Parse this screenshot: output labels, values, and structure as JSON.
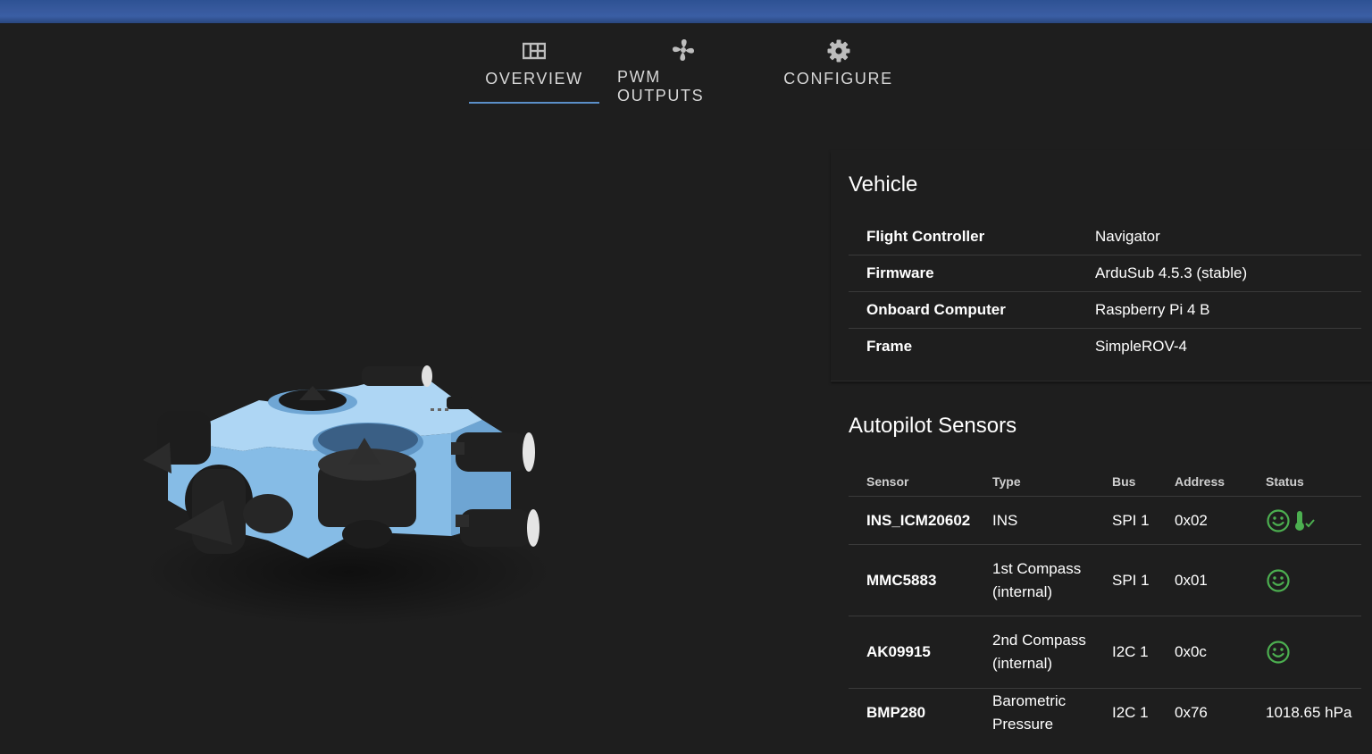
{
  "tabs": [
    {
      "label": "OVERVIEW",
      "icon": "grid-icon",
      "active": true
    },
    {
      "label": "PWM OUTPUTS",
      "icon": "fan-icon",
      "active": false
    },
    {
      "label": "CONFIGURE",
      "icon": "gear-icon",
      "active": false
    }
  ],
  "vehicle": {
    "title": "Vehicle",
    "rows": [
      {
        "key": "Flight Controller",
        "value": "Navigator"
      },
      {
        "key": "Firmware",
        "value": "ArduSub 4.5.3 (stable)"
      },
      {
        "key": "Onboard Computer",
        "value": "Raspberry Pi 4 B"
      },
      {
        "key": "Frame",
        "value": "SimpleROV-4"
      }
    ]
  },
  "sensors": {
    "title": "Autopilot Sensors",
    "columns": [
      "Sensor",
      "Type",
      "Bus",
      "Address",
      "Status"
    ],
    "rows": [
      {
        "sensor": "INS_ICM20602",
        "type": "INS",
        "bus": "SPI 1",
        "address": "0x02",
        "status": "smiley-icon,thermometer-check-icon"
      },
      {
        "sensor": "MMC5883",
        "type": "1st Compass (internal)",
        "bus": "SPI 1",
        "address": "0x01",
        "status": "smiley-icon"
      },
      {
        "sensor": "AK09915",
        "type": "2nd Compass (internal)",
        "bus": "I2C 1",
        "address": "0x0c",
        "status": "smiley-icon"
      },
      {
        "sensor": "BMP280",
        "type": "Barometric Pressure",
        "bus": "I2C 1",
        "address": "0x76",
        "status": "1018.65 hPa"
      }
    ]
  },
  "colors": {
    "accent": "#5b8fc8",
    "status_ok": "#4caf50",
    "vehicle_body": "#8fc3ea"
  }
}
